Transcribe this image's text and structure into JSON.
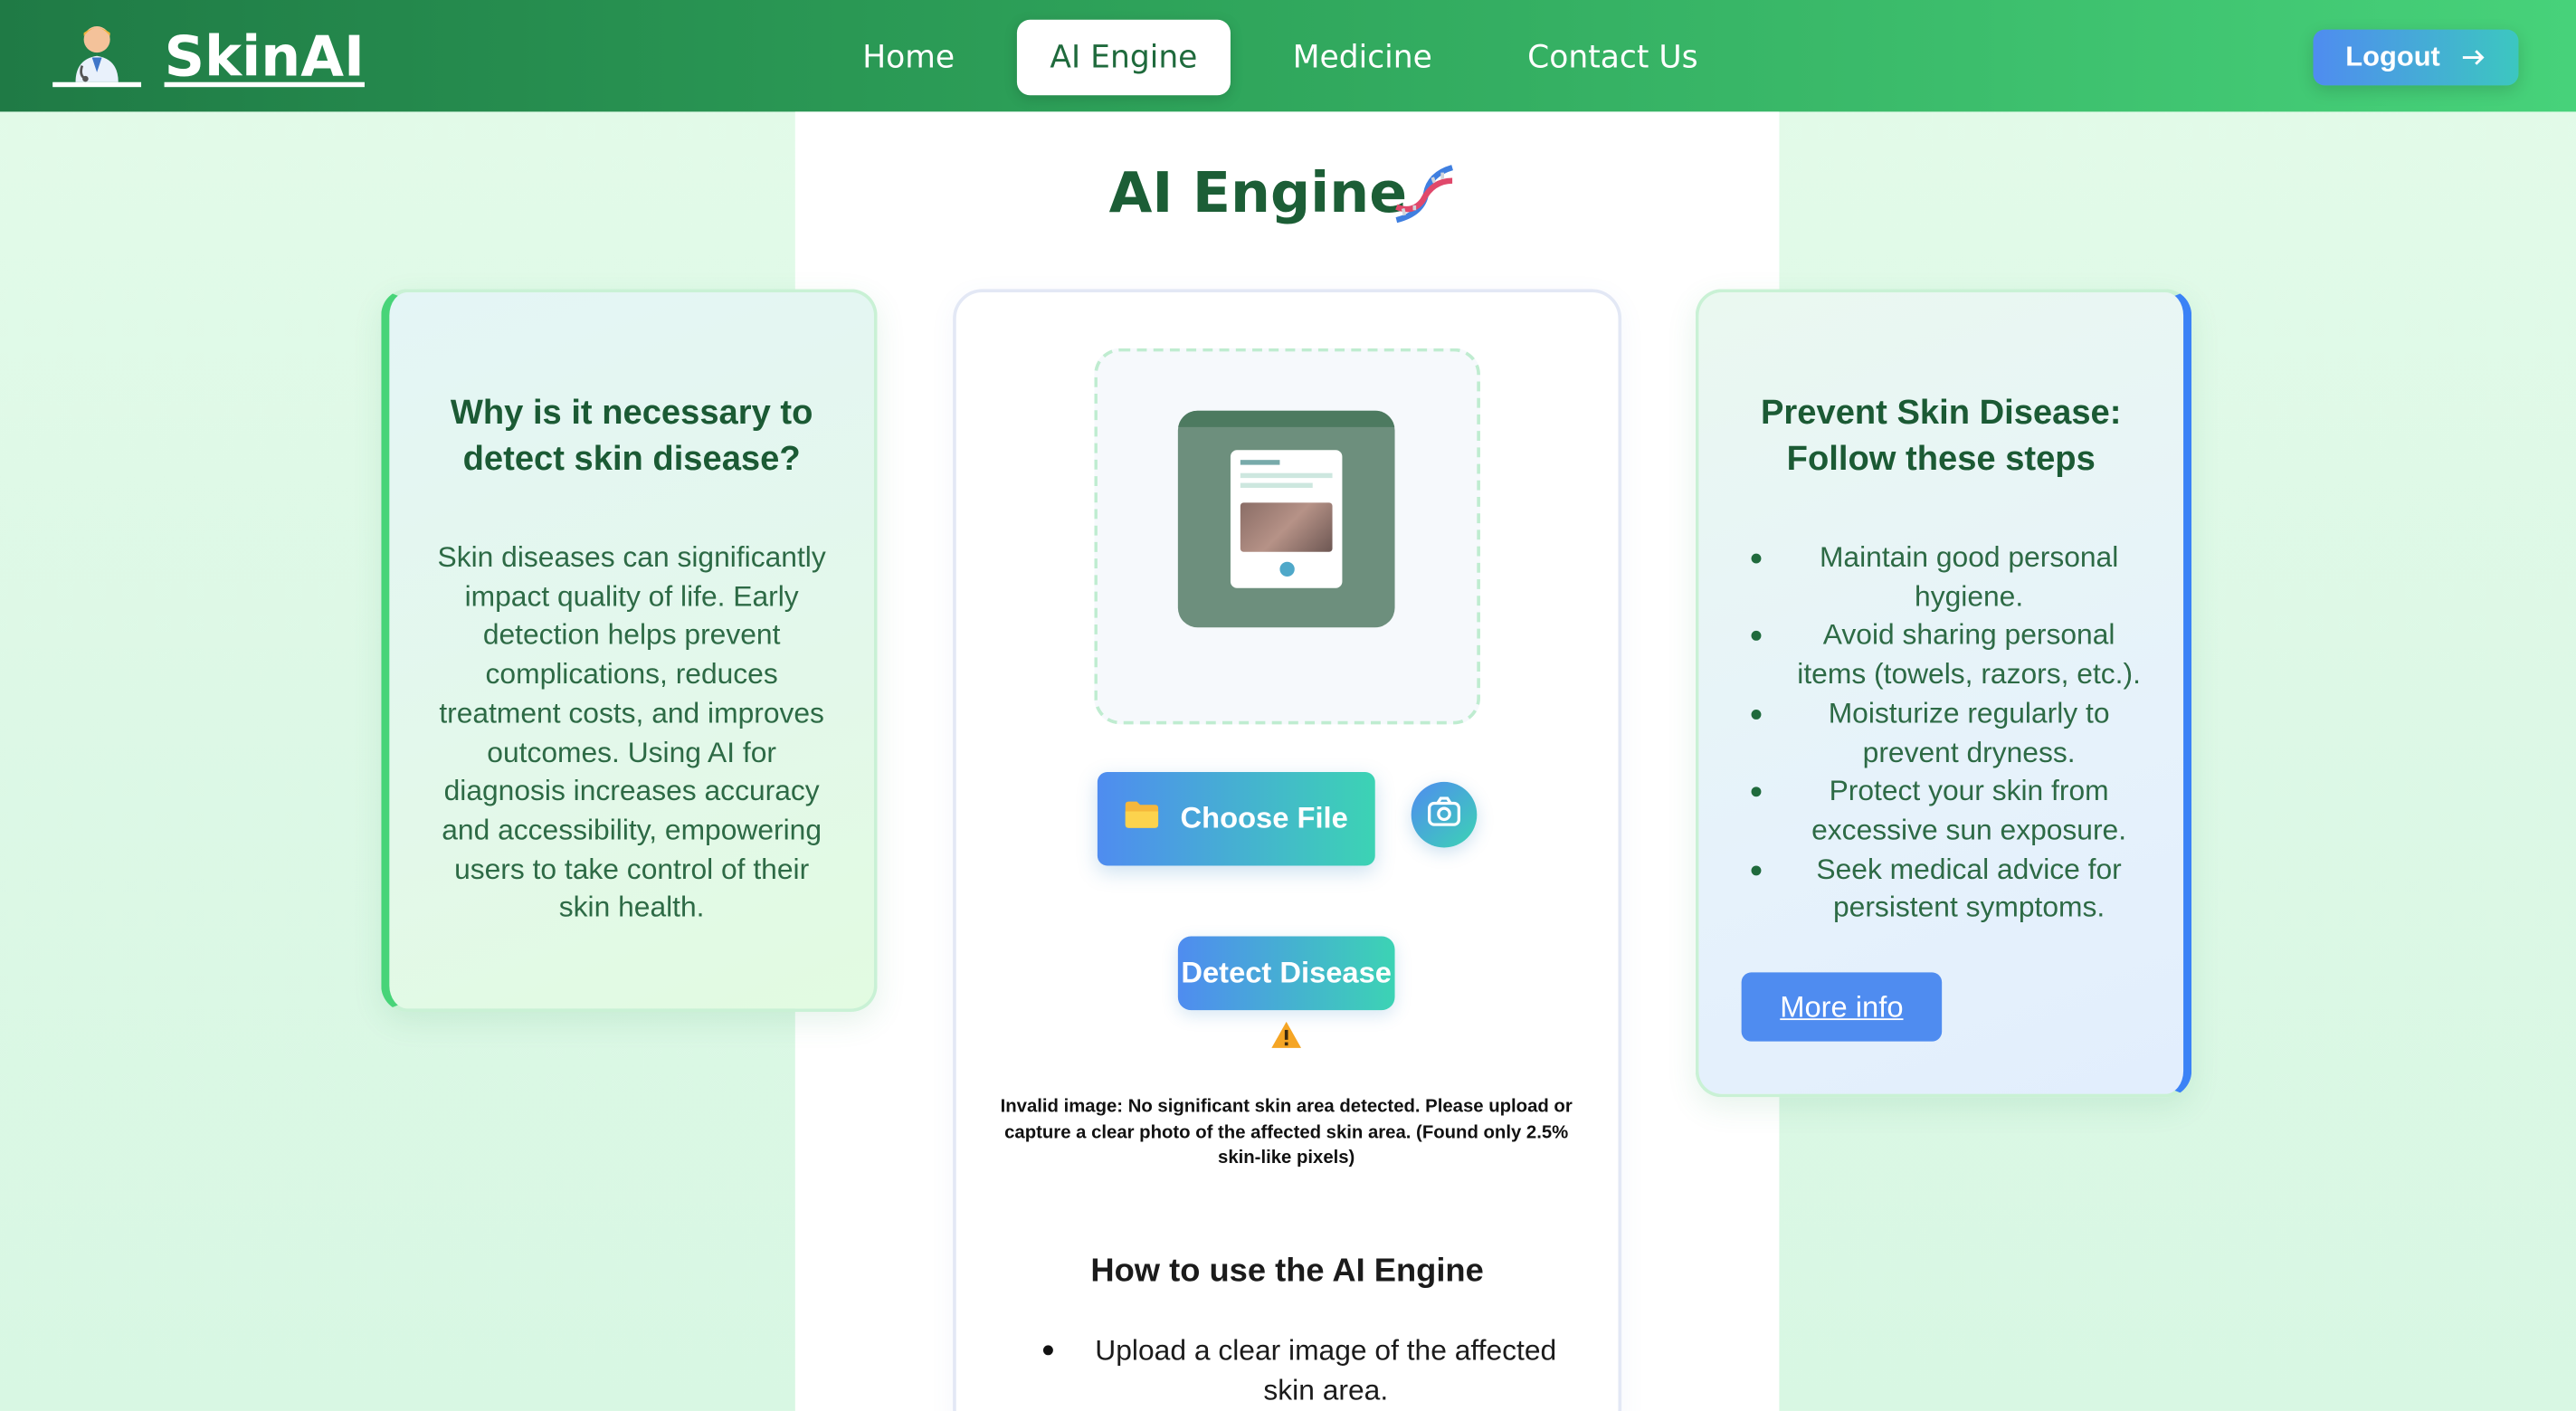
{
  "navbar": {
    "brand": "SkinAI",
    "brand_icon": "doctor-icon",
    "links": [
      {
        "label": "Home",
        "active": false
      },
      {
        "label": "AI Engine",
        "active": true
      },
      {
        "label": "Medicine",
        "active": false
      },
      {
        "label": "Contact Us",
        "active": false
      }
    ],
    "logout_label": "Logout",
    "logout_icon": "arrow-right-icon"
  },
  "page": {
    "title": "AI Engine",
    "title_icon": "dna-icon"
  },
  "left_card": {
    "title": "Why is it necessary to detect skin disease?",
    "body": "Skin diseases can significantly impact quality of life. Early detection helps prevent complications, reduces treatment costs, and improves outcomes. Using AI for diagnosis increases accuracy and accessibility, empowering users to take control of their skin health."
  },
  "right_card": {
    "title": "Prevent Skin Disease: Follow these steps",
    "steps": [
      "Maintain good personal hygiene.",
      "Avoid sharing personal items (towels, razors, etc.).",
      "Moisturize regularly to prevent dryness.",
      "Protect your skin from excessive sun exposure.",
      "Seek medical advice for persistent symptoms."
    ],
    "more_info_label": "More info"
  },
  "upload": {
    "choose_file_label": "Choose File",
    "choose_file_icon": "folder-icon",
    "camera_icon": "camera-icon",
    "detect_label": "Detect Disease",
    "warning_icon": "warning-icon",
    "error_message": "Invalid image: No significant skin area detected. Please upload or capture a clear photo of the affected skin area. (Found only 2.5% skin-like pixels)"
  },
  "howto": {
    "title": "How to use the AI Engine",
    "items": [
      "Upload a clear image of the affected skin area."
    ]
  },
  "colors": {
    "nav_start": "#1f7a45",
    "nav_end": "#47d27a",
    "accent_blue": "#4f8cf0",
    "accent_teal": "#3cd3b4",
    "heading_green": "#1c5e36"
  }
}
